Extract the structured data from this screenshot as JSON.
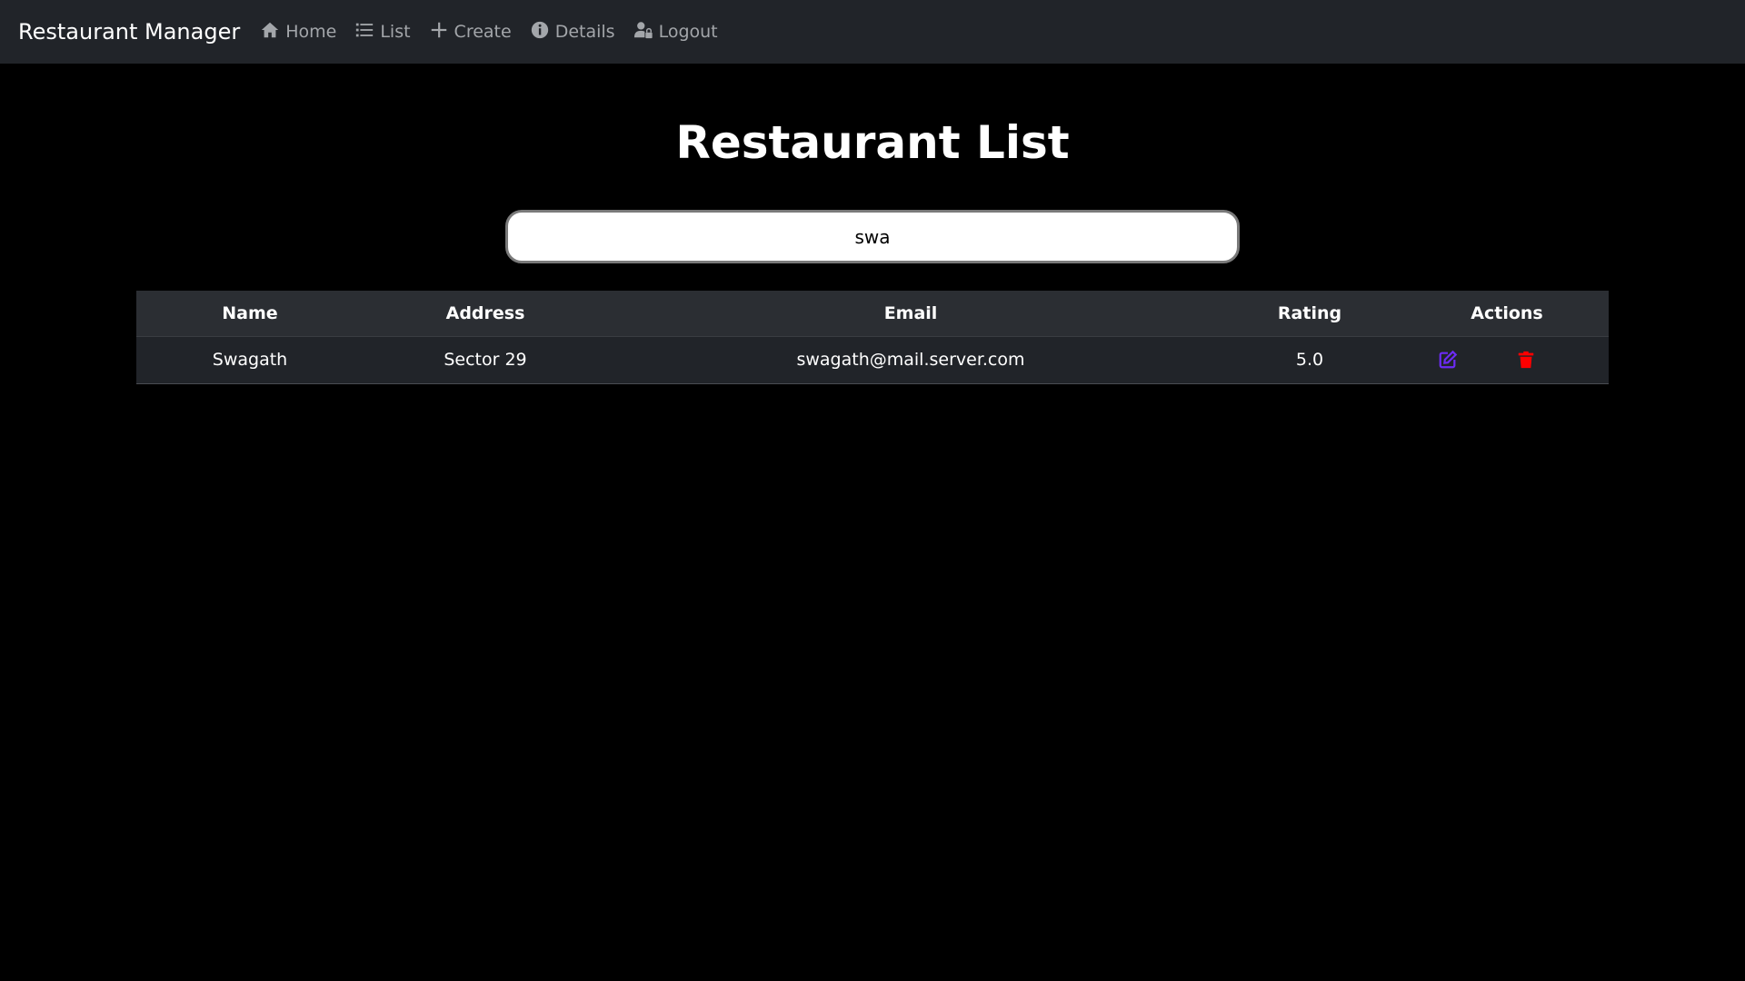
{
  "navbar": {
    "brand": "Restaurant Manager",
    "links": [
      {
        "label": "Home",
        "icon": "home-icon"
      },
      {
        "label": "List",
        "icon": "list-icon"
      },
      {
        "label": "Create",
        "icon": "plus-icon"
      },
      {
        "label": "Details",
        "icon": "info-icon"
      },
      {
        "label": "Logout",
        "icon": "user-lock-icon"
      }
    ]
  },
  "main": {
    "title": "Restaurant List",
    "search": {
      "value": "swa"
    },
    "table": {
      "columns": [
        "Name",
        "Address",
        "Email",
        "Rating",
        "Actions"
      ],
      "rows": [
        {
          "name": "Swagath",
          "address": "Sector 29",
          "email": "swagath@mail.server.com",
          "rating": "5.0"
        }
      ],
      "actions": {
        "edit_icon": "edit-icon",
        "delete_icon": "trash-icon"
      }
    }
  },
  "colors": {
    "background": "#000000",
    "navbar": "#212429",
    "nav_link": "#a3a6aa",
    "edit": "#6c2bf5",
    "delete": "#ff0000"
  }
}
